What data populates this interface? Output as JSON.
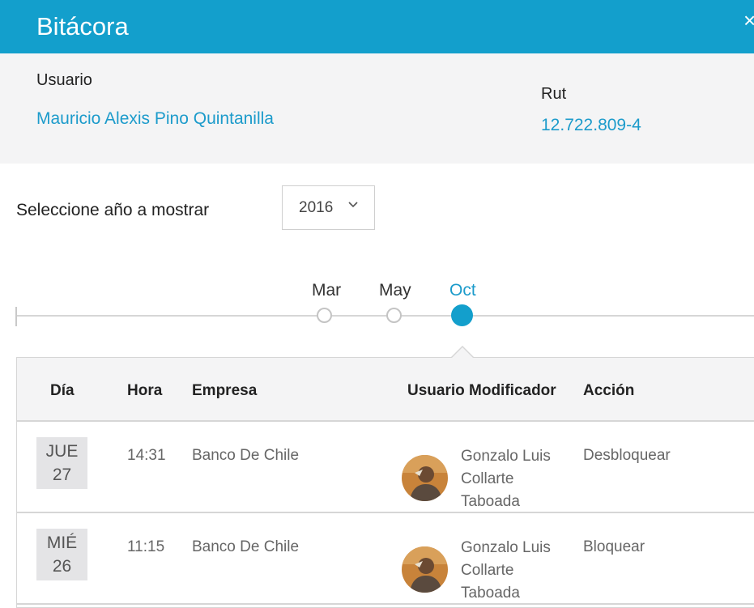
{
  "header": {
    "title": "Bitácora",
    "close_glyph": "×"
  },
  "info": {
    "user_label": "Usuario",
    "user_value": "Mauricio Alexis Pino Quintanilla",
    "rut_label": "Rut",
    "rut_value": "12.722.809-4"
  },
  "year_select": {
    "label": "Seleccione año a mostrar",
    "value": "2016",
    "icon": "chevron-down-icon"
  },
  "timeline": {
    "months": [
      {
        "label": "Mar",
        "active": false
      },
      {
        "label": "May",
        "active": false
      },
      {
        "label": "Oct",
        "active": true
      }
    ]
  },
  "table": {
    "headers": [
      "Día",
      "Hora",
      "Empresa",
      "Usuario Modificador",
      "Acción"
    ],
    "rows": [
      {
        "day_name": "JUE",
        "day_num": "27",
        "hora": "14:31",
        "empresa": "Banco De Chile",
        "usuario": "Gonzalo Luis Collarte Taboada",
        "accion": "Desbloquear"
      },
      {
        "day_name": "MIÉ",
        "day_num": "26",
        "hora": "11:15",
        "empresa": "Banco De Chile",
        "usuario": "Gonzalo Luis Collarte Taboada",
        "accion": "Bloquear"
      }
    ]
  },
  "colors": {
    "accent": "#139fcc",
    "link": "#1c9bcb",
    "panel_bg": "#f4f4f5"
  }
}
